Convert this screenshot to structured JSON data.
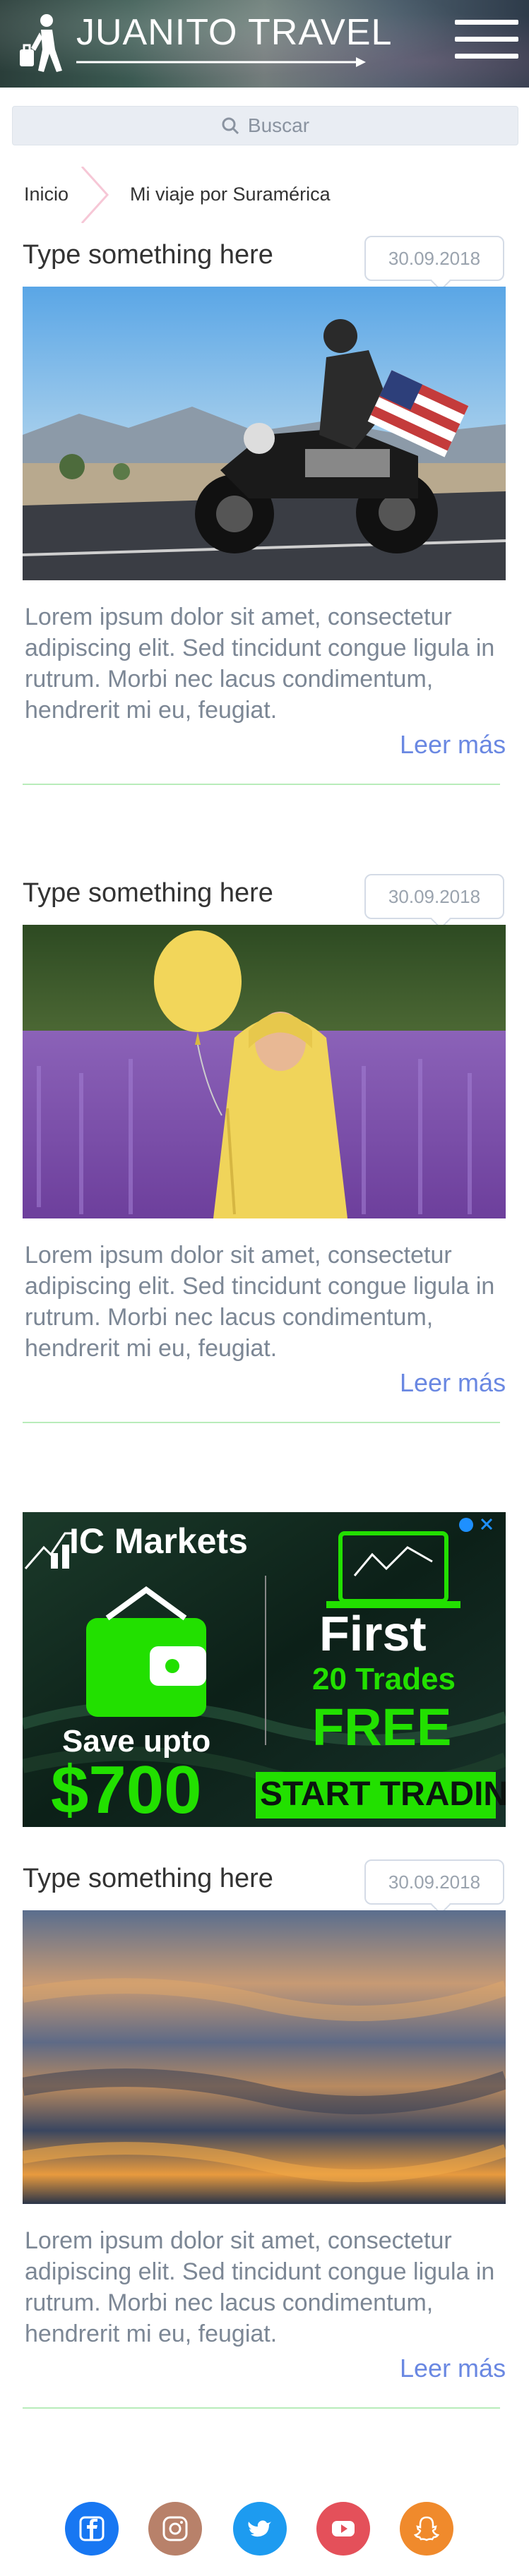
{
  "header": {
    "logo_text": "JUANITO TRAVEL",
    "logo_icon": "traveler-icon",
    "menu_icon": "hamburger-menu-icon"
  },
  "search": {
    "label": "Buscar",
    "icon": "search-icon"
  },
  "breadcrumb": {
    "items": [
      "Inicio",
      "Mi viaje por Suramérica"
    ]
  },
  "posts": [
    {
      "title": "Type something here",
      "date": "30.09.2018",
      "image": "motorcycle-rider-with-flag",
      "text": "Lorem ipsum dolor sit amet, consectetur adipiscing elit. Sed tincidunt congue ligula in rutrum. Morbi nec lacus condimentum, hendrerit mi eu, feugiat.",
      "read_more": "Leer más"
    },
    {
      "title": "Type something here",
      "date": "30.09.2018",
      "image": "child-with-yellow-balloon-in-lavender",
      "text": "Lorem ipsum dolor sit amet, consectetur adipiscing elit. Sed tincidunt congue ligula in rutrum. Morbi nec lacus condimentum, hendrerit mi eu, feugiat.",
      "read_more": "Leer más"
    },
    {
      "title": "Type something here",
      "date": "30.09.2018",
      "image": "sunset-water-waves",
      "text": "Lorem ipsum dolor sit amet, consectetur adipiscing elit. Sed tincidunt congue ligula in rutrum. Morbi nec lacus condimentum, hendrerit mi eu, feugiat.",
      "read_more": "Leer más"
    }
  ],
  "ad": {
    "brand": "IC Markets",
    "headline": "First",
    "subline": "20 Trades",
    "free": "FREE",
    "save": "Save upto",
    "amount": "$700",
    "cta": "START TRADING",
    "colors": {
      "green": "#22e000",
      "bg": "#0b1410"
    }
  },
  "social": [
    {
      "name": "facebook-icon",
      "color": "#1877f2"
    },
    {
      "name": "instagram-icon",
      "color": "#b8816a"
    },
    {
      "name": "twitter-icon",
      "color": "#1d9bf0"
    },
    {
      "name": "youtube-icon",
      "color": "#e4505a"
    },
    {
      "name": "snapchat-icon",
      "color": "#f08a2c"
    }
  ],
  "colors": {
    "accent": "#6a88e2",
    "divider": "#b8ecba",
    "body_text": "#7c8795"
  }
}
